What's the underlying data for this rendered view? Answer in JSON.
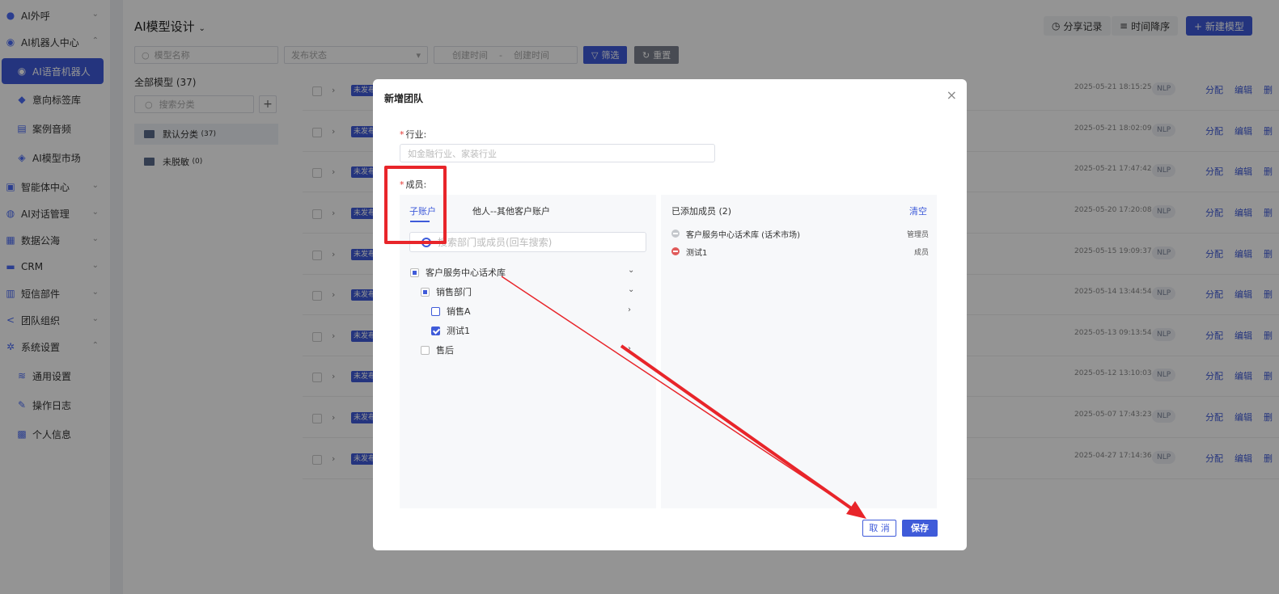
{
  "sidebar": {
    "items": [
      {
        "label": "AI外呼",
        "icon": "user-icon",
        "expanded": false
      },
      {
        "label": "AI机器人中心",
        "icon": "robot-icon",
        "expanded": true
      },
      {
        "label": "AI语音机器人",
        "icon": "robot-icon",
        "active": true
      },
      {
        "label": "意向标签库",
        "icon": "tag-icon"
      },
      {
        "label": "案例音频",
        "icon": "audio-icon"
      },
      {
        "label": "AI模型市场",
        "icon": "market-icon"
      },
      {
        "label": "智能体中心",
        "icon": "agent-icon",
        "expanded": false
      },
      {
        "label": "AI对话管理",
        "icon": "chat-icon",
        "expanded": false
      },
      {
        "label": "数据公海",
        "icon": "data-icon",
        "expanded": false
      },
      {
        "label": "CRM",
        "icon": "crm-icon",
        "expanded": false
      },
      {
        "label": "短信部件",
        "icon": "sms-icon",
        "expanded": false
      },
      {
        "label": "团队组织",
        "icon": "team-icon",
        "expanded": false
      },
      {
        "label": "系统设置",
        "icon": "settings-icon",
        "expanded": true
      },
      {
        "label": "通用设置",
        "icon": "layers-icon"
      },
      {
        "label": "操作日志",
        "icon": "pen-icon"
      },
      {
        "label": "个人信息",
        "icon": "profile-icon"
      }
    ]
  },
  "header": {
    "title": "AI模型设计",
    "share_label": "分享记录",
    "sort_label": "时间降序",
    "new_label": "+ 新建模型"
  },
  "filters": {
    "model_name_placeholder": "模型名称",
    "publish_status_placeholder": "发布状态",
    "created_from_placeholder": "创建时间",
    "range_sep": "-",
    "created_to_placeholder": "创建时间",
    "filter_label": "筛选",
    "reset_label": "重置"
  },
  "categories": {
    "title": "全部模型 (37)",
    "search_placeholder": "搜索分类",
    "add_label": "+",
    "items": [
      {
        "label": "默认分类",
        "count": "(37)"
      },
      {
        "label": "未脱敏",
        "count": "(0)"
      }
    ]
  },
  "rows": [
    {
      "tag": "未发布",
      "date": "2025-05-21 18:15:25",
      "badge": "NLP",
      "actions": [
        "分配",
        "编辑",
        "删"
      ]
    },
    {
      "tag": "未发布",
      "date": "2025-05-21 18:02:09",
      "badge": "NLP",
      "actions": [
        "分配",
        "编辑",
        "删"
      ]
    },
    {
      "tag": "未发布",
      "date": "2025-05-21 17:47:42",
      "badge": "NLP",
      "actions": [
        "分配",
        "编辑",
        "删"
      ]
    },
    {
      "tag": "未发布",
      "date": "2025-05-20 17:20:08",
      "badge": "NLP",
      "actions": [
        "分配",
        "编辑",
        "删"
      ]
    },
    {
      "tag": "未发布",
      "date": "2025-05-15 19:09:37",
      "badge": "NLP",
      "actions": [
        "分配",
        "编辑",
        "删"
      ]
    },
    {
      "tag": "未发布",
      "date": "2025-05-14 13:44:54",
      "badge": "NLP",
      "actions": [
        "分配",
        "编辑",
        "删"
      ]
    },
    {
      "tag": "未发布",
      "date": "2025-05-13 09:13:54",
      "badge": "NLP",
      "actions": [
        "分配",
        "编辑",
        "删"
      ]
    },
    {
      "tag": "未发布",
      "date": "2025-05-12 13:10:03",
      "badge": "NLP",
      "actions": [
        "分配",
        "编辑",
        "删"
      ]
    },
    {
      "tag": "未发布",
      "date": "2025-05-07 17:43:23",
      "badge": "NLP",
      "actions": [
        "分配",
        "编辑",
        "删"
      ]
    },
    {
      "tag": "未发布",
      "date": "2025-04-27 17:14:36",
      "badge": "NLP",
      "actions": [
        "分配",
        "编辑",
        "删"
      ]
    }
  ],
  "modal": {
    "title": "新增团队",
    "close": "×",
    "industry_label": "行业:",
    "industry_placeholder": "如金融行业、家装行业",
    "members_label": "成员:",
    "required_mark": "*",
    "tabs": [
      "子账户",
      "他人--其他客户账户"
    ],
    "member_search_placeholder": "搜索部门或成员(回车搜索)",
    "tree": [
      {
        "label": "客户服务中心话术库",
        "state": "indeterminate"
      },
      {
        "label": "销售部门",
        "state": "indeterminate"
      },
      {
        "label": "销售A",
        "state": "unchecked"
      },
      {
        "label": "测试1",
        "state": "checked"
      },
      {
        "label": "售后",
        "state": "unchecked"
      }
    ],
    "added_title": "已添加成员 (2)",
    "clear_label": "清空",
    "added": [
      {
        "name": "客户服务中心话术库 (话术市场)",
        "role": "管理员"
      },
      {
        "name": "测试1",
        "role": "成员"
      }
    ],
    "cancel_label": "取 消",
    "save_label": "保存"
  },
  "colors": {
    "accent": "#3f5bd9",
    "annotation": "#e8252a",
    "overlay": "rgba(0,0,0,0.42)"
  }
}
